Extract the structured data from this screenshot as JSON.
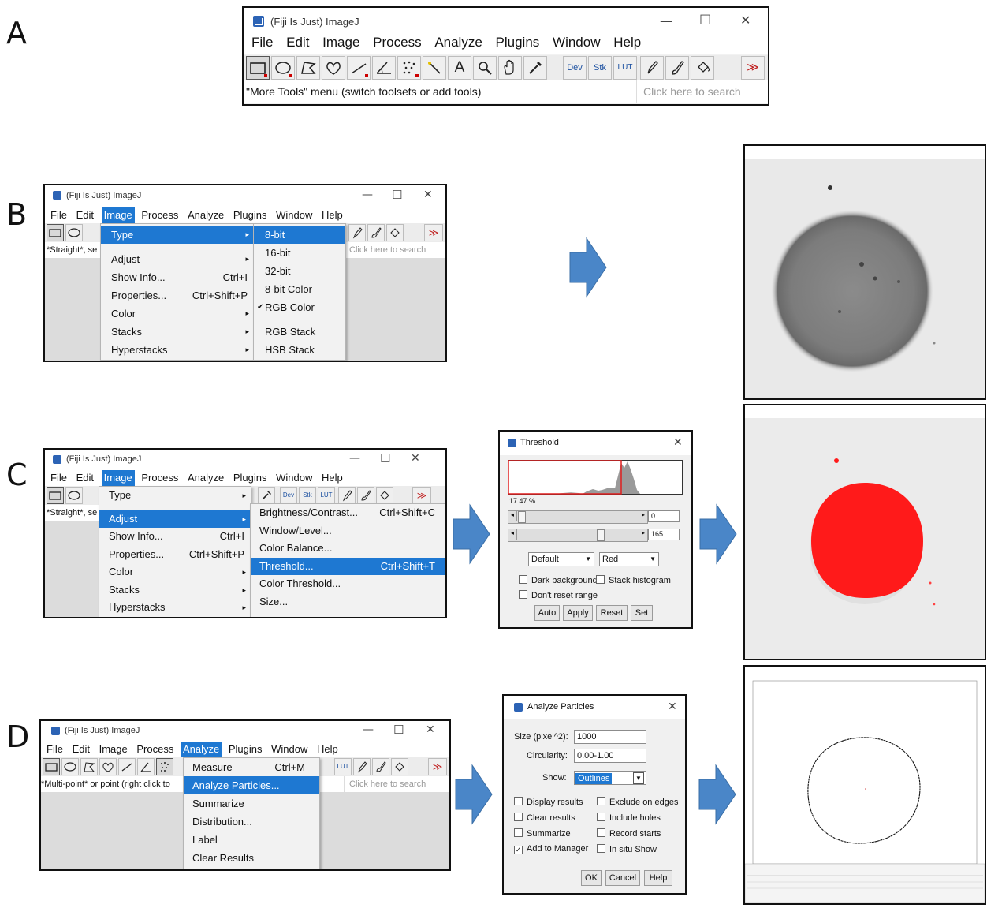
{
  "panel_labels": [
    "A",
    "B",
    "C",
    "D"
  ],
  "window_title": "(Fiji Is Just) ImageJ",
  "menus": [
    "File",
    "Edit",
    "Image",
    "Process",
    "Analyze",
    "Plugins",
    "Window",
    "Help"
  ],
  "window_controls": {
    "minimize": "—",
    "maximize": "☐",
    "close": "✕"
  },
  "toolbar": {
    "dev": "Dev",
    "stk": "Stk",
    "lut": "LUT",
    "more": "≫",
    "text_tool": "A"
  },
  "search_placeholder": "Click here to search",
  "panel_a": {
    "status": "\"More Tools\" menu (switch toolsets or add tools)"
  },
  "panel_b": {
    "status": "*Straight*, se",
    "image_menu": [
      {
        "label": "Type",
        "shortcut": "",
        "submenu": true
      },
      {
        "label": "Adjust",
        "shortcut": "",
        "submenu": true
      },
      {
        "label": "Show Info...",
        "shortcut": "Ctrl+I"
      },
      {
        "label": "Properties...",
        "shortcut": "Ctrl+Shift+P"
      },
      {
        "label": "Color",
        "shortcut": "",
        "submenu": true
      },
      {
        "label": "Stacks",
        "shortcut": "",
        "submenu": true
      },
      {
        "label": "Hyperstacks",
        "shortcut": "",
        "submenu": true
      }
    ],
    "type_submenu": [
      "8-bit",
      "16-bit",
      "32-bit",
      "8-bit Color",
      "RGB Color",
      "RGB Stack",
      "HSB Stack"
    ],
    "checked_item": "RGB Color"
  },
  "panel_c": {
    "status": "*Straight*, se",
    "image_menu": [
      {
        "label": "Type",
        "shortcut": "",
        "submenu": true
      },
      {
        "label": "Adjust",
        "shortcut": "",
        "submenu": true
      },
      {
        "label": "Show Info...",
        "shortcut": "Ctrl+I"
      },
      {
        "label": "Properties...",
        "shortcut": "Ctrl+Shift+P"
      },
      {
        "label": "Color",
        "shortcut": "",
        "submenu": true
      },
      {
        "label": "Stacks",
        "shortcut": "",
        "submenu": true
      },
      {
        "label": "Hyperstacks",
        "shortcut": "",
        "submenu": true
      }
    ],
    "adjust_submenu": [
      {
        "label": "Brightness/Contrast...",
        "shortcut": "Ctrl+Shift+C"
      },
      {
        "label": "Window/Level...",
        "shortcut": ""
      },
      {
        "label": "Color Balance...",
        "shortcut": ""
      },
      {
        "label": "Threshold...",
        "shortcut": "Ctrl+Shift+T"
      },
      {
        "label": "Color Threshold...",
        "shortcut": ""
      },
      {
        "label": "Size...",
        "shortcut": ""
      }
    ]
  },
  "threshold_dialog": {
    "title": "Threshold",
    "percent": "17.47 %",
    "min_value": "0",
    "max_value": "165",
    "method": "Default",
    "display": "Red",
    "checkboxes": [
      "Dark background",
      "Stack histogram",
      "Don't reset range"
    ],
    "buttons": [
      "Auto",
      "Apply",
      "Reset",
      "Set"
    ]
  },
  "panel_d": {
    "status": "*Multi-point* or point (right click to",
    "analyze_menu": [
      {
        "label": "Measure",
        "shortcut": "Ctrl+M"
      },
      {
        "label": "Analyze Particles...",
        "shortcut": ""
      },
      {
        "label": "Summarize",
        "shortcut": ""
      },
      {
        "label": "Distribution...",
        "shortcut": ""
      },
      {
        "label": "Label",
        "shortcut": ""
      },
      {
        "label": "Clear Results",
        "shortcut": ""
      }
    ]
  },
  "analyze_dialog": {
    "title": "Analyze Particles",
    "size_label": "Size (pixel^2):",
    "size_value": "1000",
    "circ_label": "Circularity:",
    "circ_value": "0.00-1.00",
    "show_label": "Show:",
    "show_value": "Outlines",
    "checkboxes_left": [
      {
        "label": "Display results",
        "checked": false
      },
      {
        "label": "Clear results",
        "checked": false
      },
      {
        "label": "Summarize",
        "checked": false
      },
      {
        "label": "Add to Manager",
        "checked": true
      }
    ],
    "checkboxes_right": [
      {
        "label": "Exclude on edges",
        "checked": false
      },
      {
        "label": "Include holes",
        "checked": false
      },
      {
        "label": "Record starts",
        "checked": false
      },
      {
        "label": "In situ Show",
        "checked": false
      }
    ],
    "buttons": [
      "OK",
      "Cancel",
      "Help"
    ]
  },
  "colors": {
    "accent": "#1e78d2",
    "arrow": "#4a86c8",
    "threshold_red": "#ff1a1a"
  }
}
